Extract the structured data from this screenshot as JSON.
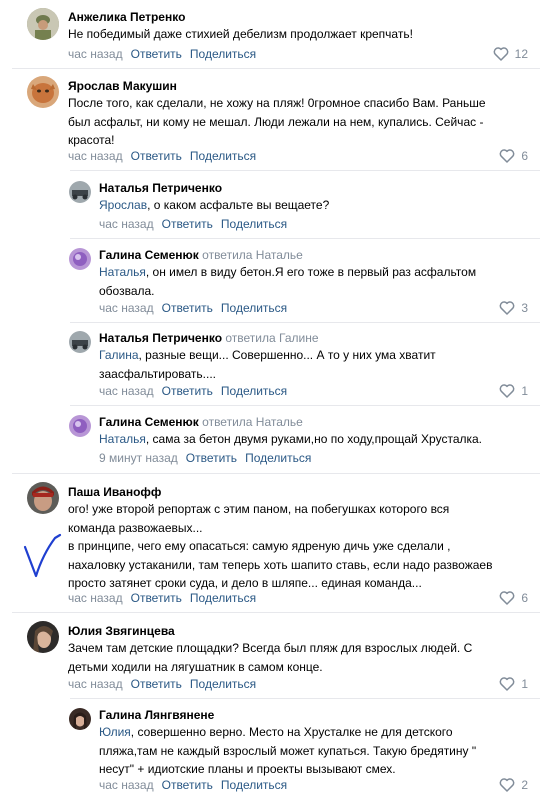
{
  "labels": {
    "reply": "Ответить",
    "share": "Поделиться"
  },
  "comments": [
    {
      "author": "Анжелика Петренко",
      "lines": [
        "Не победимый даже стихией дебелизм продолжает крепчать!"
      ],
      "time": "час назад",
      "likes": "12"
    },
    {
      "author": "Ярослав Макушин",
      "lines": [
        "После того, как сделали, не хожу на пляж! 0громное спасибо Вам. Раньше",
        "был асфальт, ни кому не мешал. Люди лежали на нем, купались. Сейчас -",
        "красота!"
      ],
      "time": "час назад",
      "likes": "6"
    },
    {
      "author": "Наталья Петриченко",
      "mention": "Ярослав",
      "lines": [
        ", о каком асфальте вы вещаете?"
      ],
      "time": "час назад"
    },
    {
      "author": "Галина Семенюк",
      "reply_to": "ответила Наталье",
      "mention": "Наталья",
      "lines": [
        ", он имел в виду бетон.Я его тоже в первый раз асфальтом",
        "обозвала."
      ],
      "time": "час назад",
      "likes": "3"
    },
    {
      "author": "Наталья Петриченко",
      "reply_to": "ответила Галине",
      "mention": "Галина",
      "lines": [
        ", разные вещи... Совершенно... А то у них ума хватит",
        "заасфальтировать...."
      ],
      "time": "час назад",
      "likes": "1"
    },
    {
      "author": "Галина Семенюк",
      "reply_to": "ответила Наталье",
      "mention": "Наталья",
      "lines": [
        ", сама за бетон двумя руками,но по ходу,прощай Хрусталка."
      ],
      "time": "9 минут назад"
    },
    {
      "author": "Паша Иванофф",
      "lines": [
        "ого! уже второй репортаж с этим паном, на побегушках которого вся",
        "команда развожаевых...",
        "в принципе, чего ему опасаться: самую ядреную дичь уже сделали ,",
        "нахаловку устаканили, там теперь хоть шапито ставь, если надо развожаев",
        "просто затянет сроки суда, и дело в шляпе... единая команда..."
      ],
      "time": "час назад",
      "likes": "6"
    },
    {
      "author": "Юлия Звягинцева",
      "lines": [
        "Зачем там детские площадки? Всегда был пляж для взрослых людей. С",
        "детьми ходили на лягушатник в самом конце."
      ],
      "time": "час назад",
      "likes": "1"
    },
    {
      "author": "Галина Лянгвянене",
      "mention": "Юлия",
      "lines": [
        ", совершенно верно. Место на Хрусталке не для детского",
        "пляжа,там не каждый взрослый может купаться. Такую бредятину \"",
        "несут\" + идиотские планы и проекты вызывают смех."
      ],
      "time": "час назад",
      "likes": "2"
    }
  ],
  "colors": {
    "link": "#2a5885",
    "secondary": "#818c99",
    "annotation": "#1f3fd0"
  }
}
